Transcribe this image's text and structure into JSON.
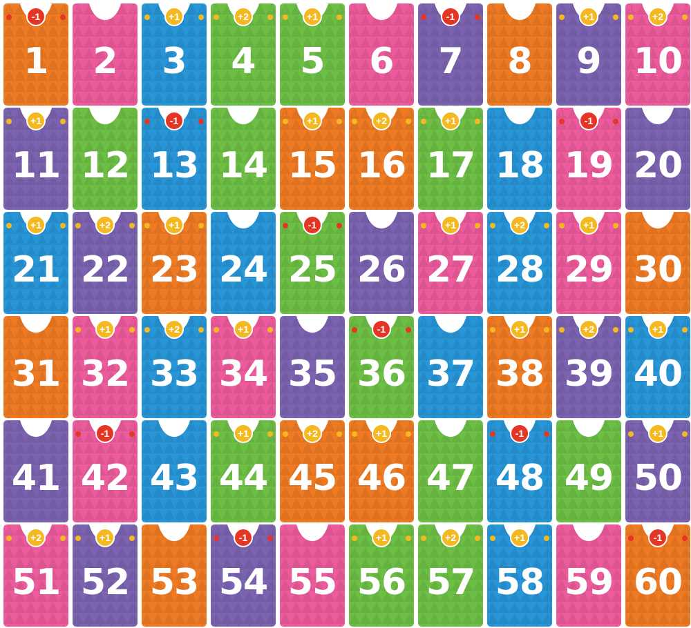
{
  "colors": {
    "orange": "#ee7a23",
    "pink": "#ec5b9b",
    "blue": "#2795d6",
    "green": "#6dbe45",
    "purple": "#7b63b0",
    "badge_gold": "#f4b820",
    "badge_red": "#e53524"
  },
  "cards": [
    {
      "n": "1",
      "color": "orange",
      "mod": "-1"
    },
    {
      "n": "2",
      "color": "pink",
      "mod": ""
    },
    {
      "n": "3",
      "color": "blue",
      "mod": "+1"
    },
    {
      "n": "4",
      "color": "green",
      "mod": "+2"
    },
    {
      "n": "5",
      "color": "green",
      "mod": "+1"
    },
    {
      "n": "6",
      "color": "pink",
      "mod": ""
    },
    {
      "n": "7",
      "color": "purple",
      "mod": "-1"
    },
    {
      "n": "8",
      "color": "orange",
      "mod": ""
    },
    {
      "n": "9",
      "color": "purple",
      "mod": "+1"
    },
    {
      "n": "10",
      "color": "pink",
      "mod": "+2"
    },
    {
      "n": "11",
      "color": "purple",
      "mod": "+1"
    },
    {
      "n": "12",
      "color": "green",
      "mod": ""
    },
    {
      "n": "13",
      "color": "blue",
      "mod": "-1"
    },
    {
      "n": "14",
      "color": "green",
      "mod": ""
    },
    {
      "n": "15",
      "color": "orange",
      "mod": "+1"
    },
    {
      "n": "16",
      "color": "orange",
      "mod": "+2"
    },
    {
      "n": "17",
      "color": "green",
      "mod": "+1"
    },
    {
      "n": "18",
      "color": "blue",
      "mod": ""
    },
    {
      "n": "19",
      "color": "pink",
      "mod": "-1"
    },
    {
      "n": "20",
      "color": "purple",
      "mod": ""
    },
    {
      "n": "21",
      "color": "blue",
      "mod": "+1"
    },
    {
      "n": "22",
      "color": "purple",
      "mod": "+2"
    },
    {
      "n": "23",
      "color": "orange",
      "mod": "+1"
    },
    {
      "n": "24",
      "color": "blue",
      "mod": ""
    },
    {
      "n": "25",
      "color": "green",
      "mod": "-1"
    },
    {
      "n": "26",
      "color": "purple",
      "mod": ""
    },
    {
      "n": "27",
      "color": "pink",
      "mod": "+1"
    },
    {
      "n": "28",
      "color": "blue",
      "mod": "+2"
    },
    {
      "n": "29",
      "color": "pink",
      "mod": "+1"
    },
    {
      "n": "30",
      "color": "orange",
      "mod": ""
    },
    {
      "n": "31",
      "color": "orange",
      "mod": ""
    },
    {
      "n": "32",
      "color": "pink",
      "mod": "+1"
    },
    {
      "n": "33",
      "color": "blue",
      "mod": "+2"
    },
    {
      "n": "34",
      "color": "pink",
      "mod": "+1"
    },
    {
      "n": "35",
      "color": "purple",
      "mod": ""
    },
    {
      "n": "36",
      "color": "green",
      "mod": "-1"
    },
    {
      "n": "37",
      "color": "blue",
      "mod": ""
    },
    {
      "n": "38",
      "color": "orange",
      "mod": "+1"
    },
    {
      "n": "39",
      "color": "purple",
      "mod": "+2"
    },
    {
      "n": "40",
      "color": "blue",
      "mod": "+1"
    },
    {
      "n": "41",
      "color": "purple",
      "mod": ""
    },
    {
      "n": "42",
      "color": "pink",
      "mod": "-1"
    },
    {
      "n": "43",
      "color": "blue",
      "mod": ""
    },
    {
      "n": "44",
      "color": "green",
      "mod": "+1"
    },
    {
      "n": "45",
      "color": "orange",
      "mod": "+2"
    },
    {
      "n": "46",
      "color": "orange",
      "mod": "+1"
    },
    {
      "n": "47",
      "color": "green",
      "mod": ""
    },
    {
      "n": "48",
      "color": "blue",
      "mod": "-1"
    },
    {
      "n": "49",
      "color": "green",
      "mod": ""
    },
    {
      "n": "50",
      "color": "purple",
      "mod": "+1"
    },
    {
      "n": "51",
      "color": "pink",
      "mod": "+2"
    },
    {
      "n": "52",
      "color": "purple",
      "mod": "+1"
    },
    {
      "n": "53",
      "color": "orange",
      "mod": ""
    },
    {
      "n": "54",
      "color": "purple",
      "mod": "-1"
    },
    {
      "n": "55",
      "color": "pink",
      "mod": ""
    },
    {
      "n": "56",
      "color": "green",
      "mod": "+1"
    },
    {
      "n": "57",
      "color": "green",
      "mod": "+2"
    },
    {
      "n": "58",
      "color": "blue",
      "mod": "+1"
    },
    {
      "n": "59",
      "color": "pink",
      "mod": ""
    },
    {
      "n": "60",
      "color": "orange",
      "mod": "-1"
    }
  ]
}
